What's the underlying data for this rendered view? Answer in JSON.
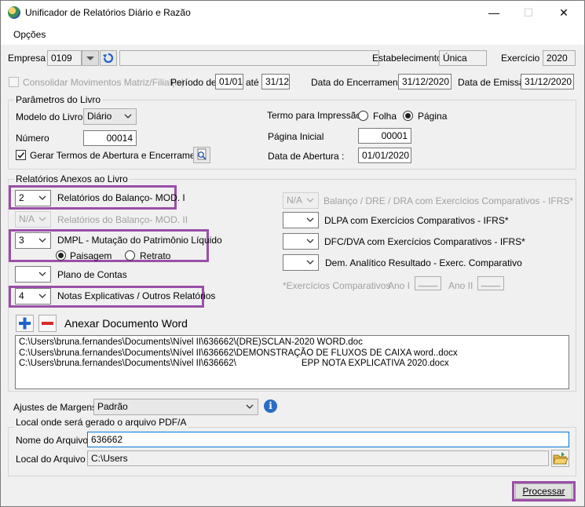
{
  "window": {
    "title": "Unificador de Relatórios Diário e Razão",
    "minimize": "—",
    "maximize": "☐",
    "close": "✕"
  },
  "menu": {
    "options": "Opções"
  },
  "header": {
    "empresa_label": "Empresa",
    "empresa_value": "0109",
    "empresa_name": "",
    "estabelecimento_label": "Estabelecimento",
    "estabelecimento_value": "Única",
    "exercicio_label": "Exercício",
    "exercicio_value": "2020",
    "consolidar_label": "Consolidar Movimentos Matriz/Filial(is)",
    "periodo_label": "Período de",
    "periodo_de": "01/01",
    "ate_label": "até",
    "periodo_ate": "31/12",
    "data_encerramento_label": "Data do Encerramento",
    "data_encerramento": "31/12/2020",
    "data_emissao_label": "Data de Emissão",
    "data_emissao": "31/12/2020"
  },
  "parametros": {
    "title": "Parâmetros do Livro",
    "modelo_label": "Modelo do Livro",
    "modelo_value": "Diário",
    "numero_label": "Número",
    "numero_value": "00014",
    "gerar_termos_label": "Gerar Termos de Abertura e Encerramento",
    "termo_label": "Termo para Impressão",
    "folha_label": "Folha",
    "pagina_label": "Página",
    "pagina_inicial_label": "Página Inicial",
    "pagina_inicial_value": "00001",
    "data_abertura_label": "Data de Abertura :",
    "data_abertura_value": "01/01/2020"
  },
  "anexos": {
    "title": "Relatórios Anexos ao Livro",
    "balanco_i_value": "2",
    "balanco_i_label": "Relatórios do Balanço- MOD. I",
    "balanco_ii_value": "N/A",
    "balanco_ii_label": "Relatórios do Balanço- MOD. II",
    "dmpl_value": "3",
    "dmpl_label": "DMPL - Mutação do Patrimônio Líquido",
    "paisagem_label": "Paisagem",
    "retrato_label": "Retrato",
    "plano_value": "",
    "plano_label": "Plano de Contas",
    "notas_value": "4",
    "notas_label": "Notas Explicativas / Outros Relatórios",
    "ifrs_value": "N/A",
    "ifrs_label": "Balanço / DRE / DRA com Exercícios Comparativos - IFRS*",
    "dlpa_value": "",
    "dlpa_label": "DLPA com Exercícios Comparativos - IFRS*",
    "dfc_value": "",
    "dfc_label": "DFC/DVA com Exercícios Comparativos - IFRS*",
    "dem_value": "",
    "dem_label": "Dem. Analítico Resultado - Exerc. Comparativo",
    "exercicios_label": "*Exercícios Comparativos",
    "ano1_label": "Ano I",
    "ano2_label": "Ano II",
    "ano1_value": "____",
    "ano2_value": "____",
    "anexar_label": "Anexar Documento Word",
    "documents": [
      "C:\\Users\\bruna.fernandes\\Documents\\Nível II\\636662\\(DRE)SCLAN-2020 WORD.doc",
      "C:\\Users\\bruna.fernandes\\Documents\\Nível II\\636662\\DEMONSTRAÇÃO DE FLUXOS DE CAIXA word..docx",
      "C:\\Users\\bruna.fernandes\\Documents\\Nível II\\636662\\                          EPP NOTA EXPLICATIVA 2020.docx"
    ]
  },
  "margens": {
    "label": "Ajustes de Margens",
    "value": "Padrão"
  },
  "local": {
    "title": "Local onde será gerado o arquivo PDF/A",
    "nome_label": "Nome do Arquivo",
    "nome_value": "636662",
    "local_label": "Local do Arquivo",
    "local_value": "C:\\Users"
  },
  "processar_label": "Processar",
  "colors": {
    "highlight": "#9a4fa8",
    "plus": "#1f63c9",
    "minus": "#d62c2c",
    "info": "#2b6cc4"
  }
}
